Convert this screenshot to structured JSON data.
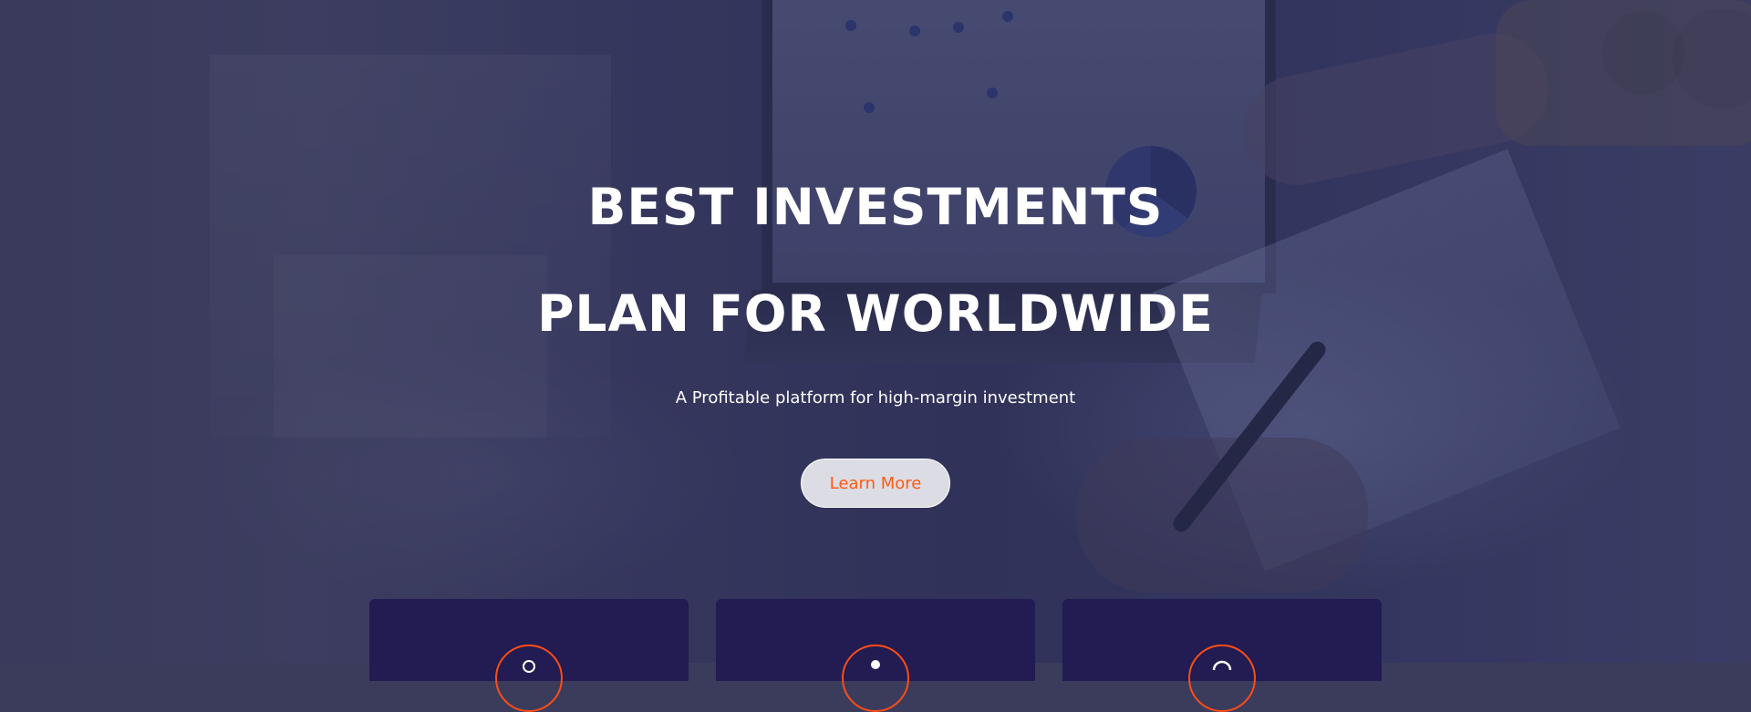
{
  "hero": {
    "title_line1": "BEST INVESTMENTS",
    "title_line2": "PLAN FOR WORLDWIDE",
    "subtitle": "A Profitable platform for high-margin investment",
    "cta_label": "Learn More"
  },
  "features": [
    {
      "icon": "user-icon"
    },
    {
      "icon": "person-icon"
    },
    {
      "icon": "support-icon"
    }
  ],
  "colors": {
    "accent": "#ff5a12",
    "card_bg": "#221c52",
    "overlay": "#2a2c58"
  }
}
